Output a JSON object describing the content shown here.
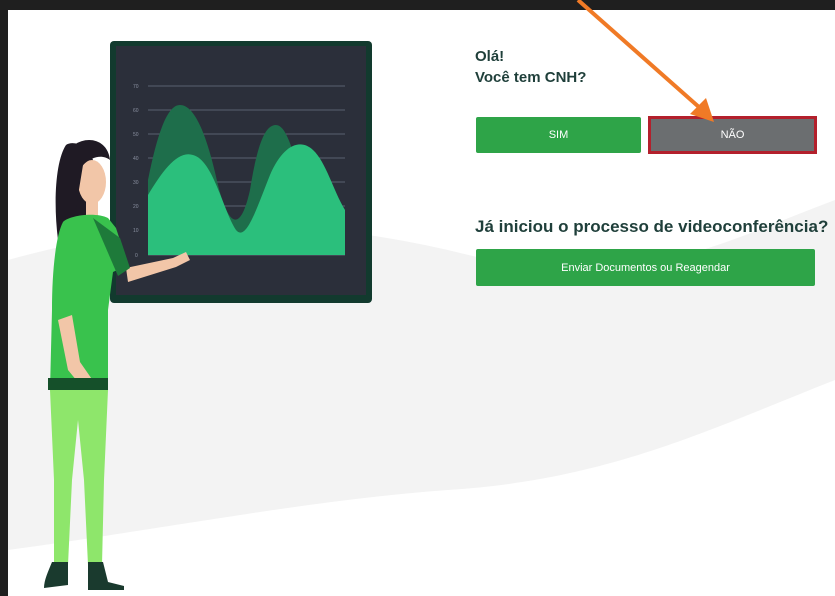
{
  "greeting": {
    "line1": "Olá!",
    "line2": "Você tem CNH?"
  },
  "cnh_buttons": {
    "yes_label": "SIM",
    "no_label": "NÃO"
  },
  "videoconference": {
    "question": "Já iniciou o processo de videoconferência?",
    "button_label": "Enviar Documentos ou Reagendar"
  },
  "colors": {
    "primary_green": "#2ea448",
    "selected_gray": "#6b6e70",
    "highlight_red": "#b3202c",
    "annotation_arrow": "#f07a26",
    "text_dark": "#1f3f3a"
  },
  "illustration": {
    "chart_axis_labels": [
      "70",
      "60",
      "50",
      "40",
      "30",
      "20",
      "10",
      "0"
    ]
  }
}
